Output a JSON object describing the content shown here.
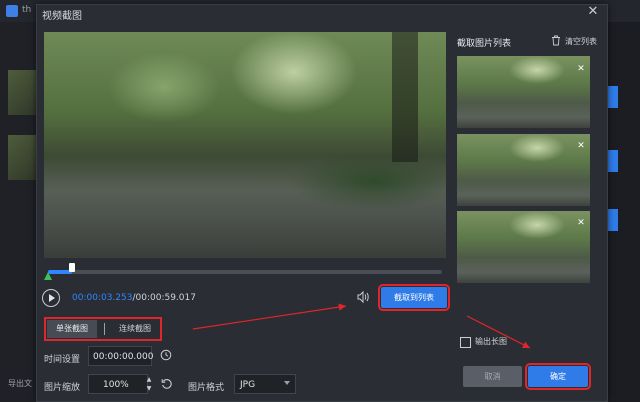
{
  "background_app": {
    "app_name": "th",
    "left_label": "导出文"
  },
  "dialog": {
    "title": "视频截图",
    "close_icon": "close-icon"
  },
  "player": {
    "current_time": "00:00:03.253",
    "separator": "/",
    "total_time": "00:00:59.017",
    "progress": 0.06,
    "capture_to_list_label": "截取到列表"
  },
  "mode": {
    "single_label": "单张截图",
    "continuous_label": "连续截图",
    "selected": "single"
  },
  "settings": {
    "time_label": "时间设置",
    "time_value": "00:00:00.000",
    "zoom_label": "图片缩放",
    "zoom_value": "100%",
    "format_label": "图片格式",
    "format_value": "JPG"
  },
  "panel": {
    "list_title": "截取图片列表",
    "clear_label": "清空列表",
    "thumbnails_count": 3,
    "export_long_label": "输出长图",
    "export_long_checked": false
  },
  "footer": {
    "cancel_label": "取消",
    "confirm_label": "确定"
  },
  "colors": {
    "accent": "#2f7be8",
    "highlight_red": "#e0262a",
    "timeline_start": "#3fbf5a"
  }
}
